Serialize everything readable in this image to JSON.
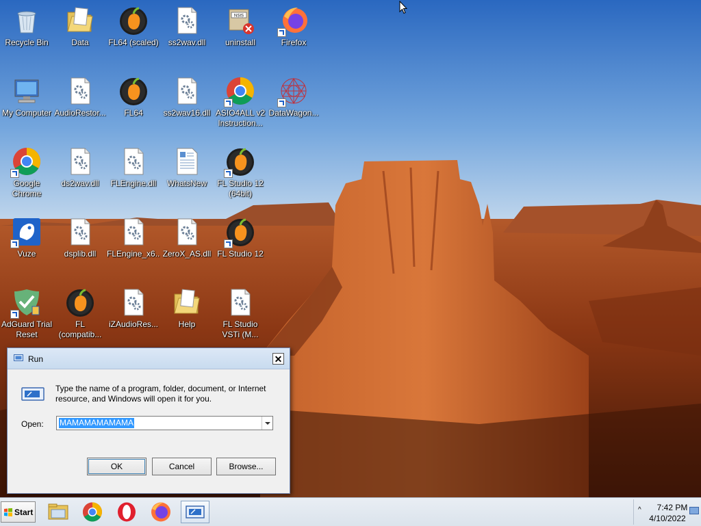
{
  "desktop": {
    "icons": [
      {
        "label": "Recycle Bin",
        "icon": "recycle-bin-icon"
      },
      {
        "label": "Data",
        "icon": "folder-icon"
      },
      {
        "label": "FL64 (scaled)",
        "icon": "fl-studio-icon"
      },
      {
        "label": "ss2wav.dll",
        "icon": "dll-file-icon"
      },
      {
        "label": "uninstall",
        "icon": "nsis-uninstall-icon"
      },
      {
        "label": "Firefox",
        "icon": "firefox-icon"
      },
      {
        "label": "My Computer",
        "icon": "computer-icon"
      },
      {
        "label": "AudioRestor...",
        "icon": "dll-file-icon"
      },
      {
        "label": "FL64",
        "icon": "fl-studio-icon"
      },
      {
        "label": "ss2wav16.dll",
        "icon": "dll-file-icon"
      },
      {
        "label": "ASIO4ALL v2",
        "label2": "Instruction...",
        "icon": "chrome-icon"
      },
      {
        "label": "DataWagon...",
        "icon": "datawagon-icon"
      },
      {
        "label": "Google",
        "label2": "Chrome",
        "icon": "chrome-icon"
      },
      {
        "label": "ds2wav.dll",
        "icon": "dll-file-icon"
      },
      {
        "label": "FLEngine.dll",
        "icon": "dll-file-icon"
      },
      {
        "label": "WhatsNew",
        "icon": "document-icon"
      },
      {
        "label": "FL Studio 12",
        "label2": "(64bit)",
        "icon": "fl-studio-icon"
      },
      {
        "label": "Vuze",
        "icon": "vuze-icon"
      },
      {
        "label": "dsplib.dll",
        "icon": "dll-file-icon"
      },
      {
        "label": "FLEngine_x6...",
        "icon": "dll-file-icon"
      },
      {
        "label": "ZeroX_AS.dll",
        "icon": "dll-file-icon"
      },
      {
        "label": "FL Studio 12",
        "icon": "fl-studio-icon"
      },
      {
        "label": "AdGuard Trial",
        "label2": "Reset",
        "icon": "adguard-icon"
      },
      {
        "label": "FL",
        "label2": "(compatib...",
        "icon": "fl-studio-icon"
      },
      {
        "label": "iZAudioRes...",
        "icon": "dll-file-icon"
      },
      {
        "label": "Help",
        "icon": "folder-icon"
      },
      {
        "label": "FL Studio",
        "label2": "VSTi (M...",
        "icon": "dll-file-icon"
      }
    ]
  },
  "run_dialog": {
    "title": "Run",
    "description": "Type the name of a program, folder, document, or Internet resource, and Windows will open it for you.",
    "open_label": "Open:",
    "open_value": "MAMAMAMAMAMA",
    "ok_label": "OK",
    "cancel_label": "Cancel",
    "browse_label": "Browse...",
    "close_glyph": "✕"
  },
  "taskbar": {
    "start_label": "Start",
    "pinned": [
      "file-explorer-icon",
      "chrome-icon",
      "opera-icon",
      "firefox-icon",
      "run-icon"
    ],
    "tray_chevron": "^",
    "time": "7:42 PM",
    "date": "4/10/2022"
  }
}
